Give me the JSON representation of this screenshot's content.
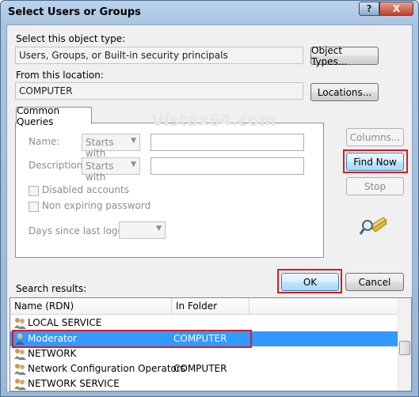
{
  "window": {
    "title": "Select Users or Groups",
    "help_label": "?",
    "close_label": "X"
  },
  "object_type": {
    "label": "Select this object type:",
    "value": "Users, Groups, or Built-in security principals",
    "button": "Object Types..."
  },
  "location": {
    "label": "From this location:",
    "value": "COMPUTER",
    "button": "Locations..."
  },
  "queries": {
    "tab_label": "Common Queries",
    "name_label": "Name:",
    "name_mode": "Starts with",
    "description_label": "Description:",
    "description_mode": "Starts with",
    "disabled_accounts": "Disabled accounts",
    "non_expiring": "Non expiring password",
    "days_label": "Days since last logon:",
    "days_value": ""
  },
  "watermark": "Vistax64.com",
  "side_buttons": {
    "columns": "Columns...",
    "find_now": "Find Now",
    "stop": "Stop"
  },
  "footer": {
    "search_results_label": "Search results:",
    "ok": "OK",
    "cancel": "Cancel"
  },
  "results": {
    "columns": [
      "Name (RDN)",
      "In Folder"
    ],
    "rows": [
      {
        "name": "LOCAL SERVICE",
        "folder": "",
        "icon": "group-icon"
      },
      {
        "name": "Moderator",
        "folder": "COMPUTER",
        "icon": "user-icon",
        "selected": true
      },
      {
        "name": "NETWORK",
        "folder": "",
        "icon": "group-icon"
      },
      {
        "name": "Network Configuration Operators",
        "folder": "COMPUTER",
        "icon": "group-icon"
      },
      {
        "name": "NETWORK SERVICE",
        "folder": "",
        "icon": "group-icon"
      }
    ]
  },
  "colors": {
    "highlight": "#d21c27",
    "selection": "#3399ff"
  }
}
